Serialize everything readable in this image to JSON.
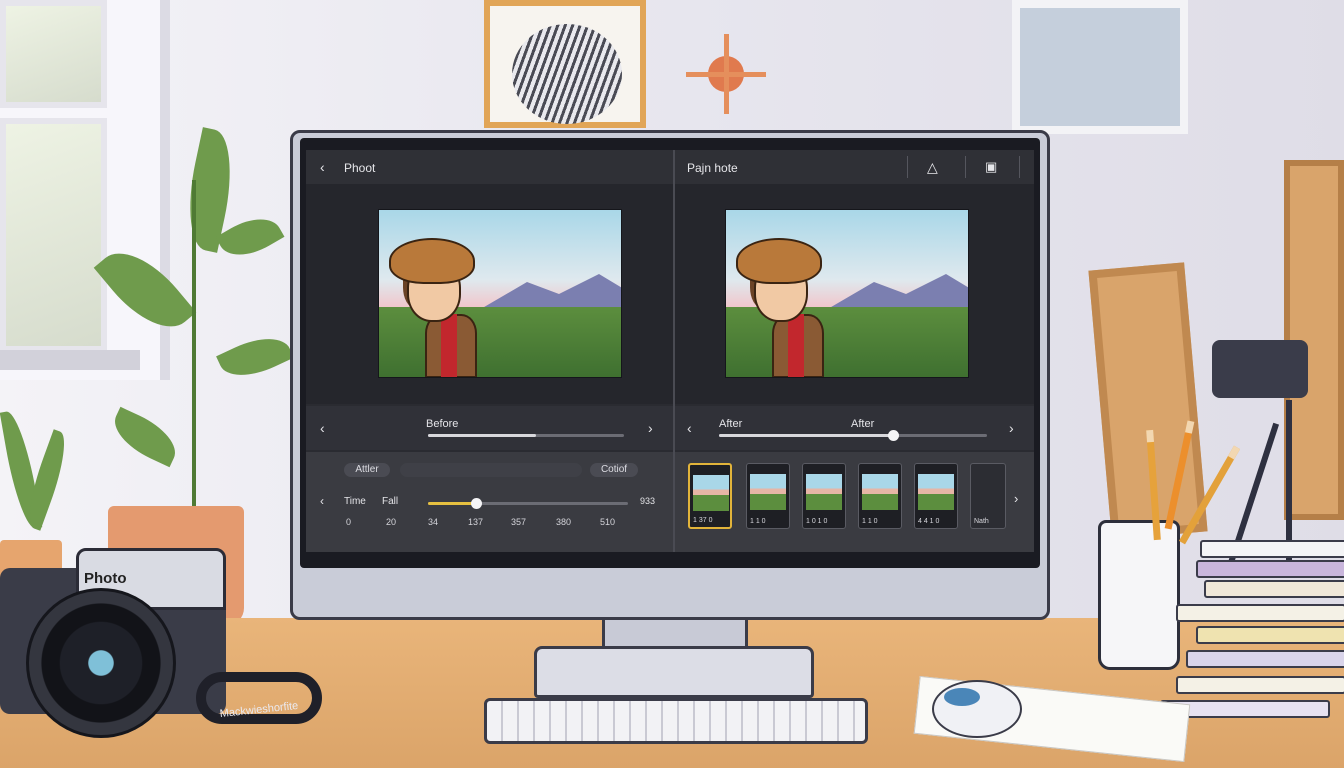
{
  "scene": {
    "camera_label": "Photo",
    "strap_text": "Mackwieshorfite"
  },
  "editor": {
    "left_title": "Phoot",
    "right_title": "Pajn hote",
    "before_label": "Before",
    "after_label_left": "After",
    "after_label_right": "After",
    "toggle_left": "Attler",
    "toggle_right": "Cotiof",
    "time_label": "Time",
    "fall_label": "Fall",
    "slider_end_value": "933",
    "ticks": [
      "0",
      "20",
      "34",
      "137",
      "357",
      "380",
      "510"
    ],
    "compare_slider_value": 0.65,
    "before_slider_value": 0.55,
    "time_slider_value": 0.24,
    "thumbnails": [
      {
        "caption": "1 37 0",
        "selected": true
      },
      {
        "caption": "1 1 0",
        "selected": false
      },
      {
        "caption": "1 0 1 0",
        "selected": false
      },
      {
        "caption": "1 1 0",
        "selected": false
      },
      {
        "caption": "4 4 1 0",
        "selected": false
      },
      {
        "caption": "Nath",
        "selected": false
      }
    ],
    "icons": {
      "back": "chevron-left-icon",
      "person": "person-icon",
      "share": "export-icon",
      "prev": "chevron-left-icon",
      "next": "chevron-right-icon"
    }
  }
}
